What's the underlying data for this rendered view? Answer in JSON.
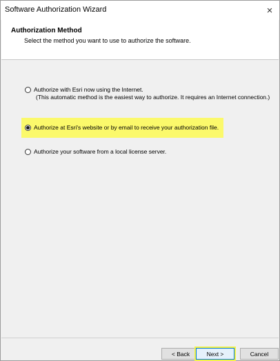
{
  "window": {
    "title": "Software Authorization Wizard",
    "close_glyph": "×"
  },
  "header": {
    "title": "Authorization Method",
    "description": "Select the method you want to use to authorize the software."
  },
  "options": [
    {
      "line1": "Authorize with Esri now using the Internet.",
      "line2": "(This automatic method is the easiest way to authorize. It requires an Internet connection.)",
      "selected": false
    },
    {
      "line1": "Authorize at Esri's website or by email to receive your authorization file.",
      "selected": true
    },
    {
      "line1": "Authorize your software from a local license server.",
      "selected": false
    }
  ],
  "buttons": {
    "back": "< Back",
    "next": "Next >",
    "cancel": "Cancel"
  },
  "colors": {
    "highlight": "#fbf96b",
    "accent": "#0078d7"
  }
}
